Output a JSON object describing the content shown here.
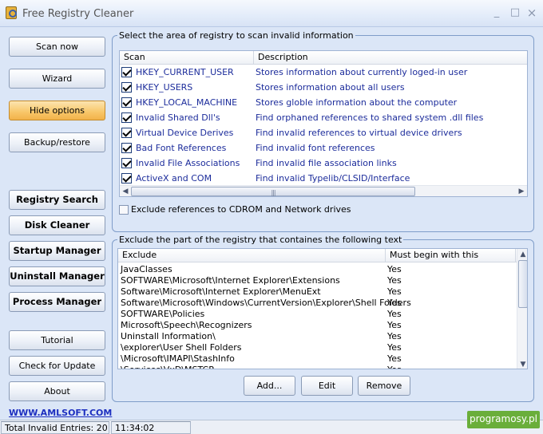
{
  "window": {
    "title": "Free Registry Cleaner",
    "minimize_glyph": "_",
    "maximize_glyph": "□",
    "close_glyph": "×"
  },
  "nav": {
    "scan_now": "Scan now",
    "wizard": "Wizard",
    "hide_options": "Hide options",
    "backup_restore": "Backup/restore",
    "registry_search": "Registry Search",
    "disk_cleaner": "Disk Cleaner",
    "startup_manager": "Startup Manager",
    "uninstall_manager": "Uninstall Manager",
    "process_manager": "Process Manager",
    "tutorial": "Tutorial",
    "check_for_update": "Check for Update",
    "about": "About",
    "website": "WWW.AMLSOFT.COM"
  },
  "scan_area": {
    "legend": "Select the area of registry to scan invalid information",
    "columns": [
      "Scan",
      "Description"
    ],
    "rows": [
      {
        "name": "HKEY_CURRENT_USER",
        "description": "Stores information about currently loged-in user",
        "checked": true
      },
      {
        "name": "HKEY_USERS",
        "description": "Stores information about all users",
        "checked": true
      },
      {
        "name": "HKEY_LOCAL_MACHINE",
        "description": "Stores globle information about the computer",
        "checked": true
      },
      {
        "name": "Invalid Shared Dll's",
        "description": "Find orphaned references to shared system .dll files",
        "checked": true
      },
      {
        "name": "Virtual Device Derives",
        "description": "Find invalid references to virtual device drivers",
        "checked": true
      },
      {
        "name": "Bad Font References",
        "description": "Find invalid font references",
        "checked": true
      },
      {
        "name": "Invalid File Associations",
        "description": "Find invalid file association links",
        "checked": true
      },
      {
        "name": "ActiveX and COM",
        "description": "Find invalid Typelib/CLSID/Interface",
        "checked": true
      }
    ],
    "exclude_cdrom_label": "Exclude references to CDROM and Network drives",
    "exclude_cdrom_checked": false
  },
  "exclude_area": {
    "legend": "Exclude the part of the registry that containes the following text",
    "columns": [
      "Exclude",
      "Must begin with this"
    ],
    "rows": [
      {
        "text": "JavaClasses",
        "must_begin": "Yes"
      },
      {
        "text": "SOFTWARE\\Microsoft\\Internet Explorer\\Extensions",
        "must_begin": "Yes"
      },
      {
        "text": "Software\\Microsoft\\Internet Explorer\\MenuExt",
        "must_begin": "Yes"
      },
      {
        "text": "Software\\Microsoft\\Windows\\CurrentVersion\\Explorer\\Shell Folders",
        "must_begin": "Yes"
      },
      {
        "text": "SOFTWARE\\Policies",
        "must_begin": "Yes"
      },
      {
        "text": "Microsoft\\Speech\\Recognizers",
        "must_begin": "Yes"
      },
      {
        "text": "Uninstall Information\\",
        "must_begin": "Yes"
      },
      {
        "text": "\\explorer\\User Shell Folders",
        "must_begin": "Yes"
      },
      {
        "text": "\\Microsoft\\IMAPI\\StashInfo",
        "must_begin": "Yes"
      },
      {
        "text": "\\Services\\VxD\\MSTCP",
        "must_begin": "Yes"
      }
    ],
    "add_label": "Add...",
    "edit_label": "Edit",
    "remove_label": "Remove"
  },
  "status": {
    "total_invalid_entries": "Total Invalid Entries: 20",
    "time": "11:34:02"
  },
  "watermark": "programosy.pl",
  "colors": {
    "window_bg": "#dbe6f7",
    "active_button": "#f8c668",
    "link": "#1d2fc0",
    "list_text": "#1c2c9b",
    "watermark_bg": "#6aae3a"
  }
}
